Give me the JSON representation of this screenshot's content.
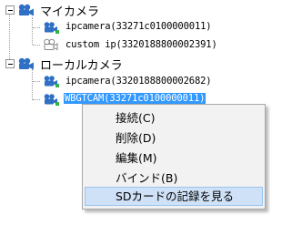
{
  "tree": {
    "groups": [
      {
        "label": "マイカメラ",
        "icon": "camera-group-icon",
        "expanded": true,
        "items": [
          {
            "label": "ipcamera(33271c0100000011)",
            "icon": "camera-online-icon",
            "selected": false
          },
          {
            "label": "custom ip(3320188800002391)",
            "icon": "camera-offline-icon",
            "selected": false
          }
        ]
      },
      {
        "label": "ローカルカメラ",
        "icon": "camera-group-icon",
        "expanded": true,
        "items": [
          {
            "label": "ipcamera(3320188800002682)",
            "icon": "camera-online-icon",
            "selected": false
          },
          {
            "label": "WBGTCAM(33271c0100000011)",
            "icon": "camera-online-icon",
            "selected": true
          }
        ]
      }
    ]
  },
  "context_menu": {
    "items": [
      {
        "label": "接続(C)",
        "highlighted": false
      },
      {
        "label": "削除(D)",
        "highlighted": false
      },
      {
        "label": "編集(M)",
        "highlighted": false
      },
      {
        "label": "バインド(B)",
        "highlighted": false
      },
      {
        "label": "SDカードの記録を見る",
        "highlighted": true
      }
    ]
  },
  "colors": {
    "icon_blue": "#2f6fc4",
    "icon_green": "#32b24a",
    "icon_grey": "#8a8a8a",
    "selection": "#3399ff",
    "menu_highlight": "#cfe1f6"
  }
}
